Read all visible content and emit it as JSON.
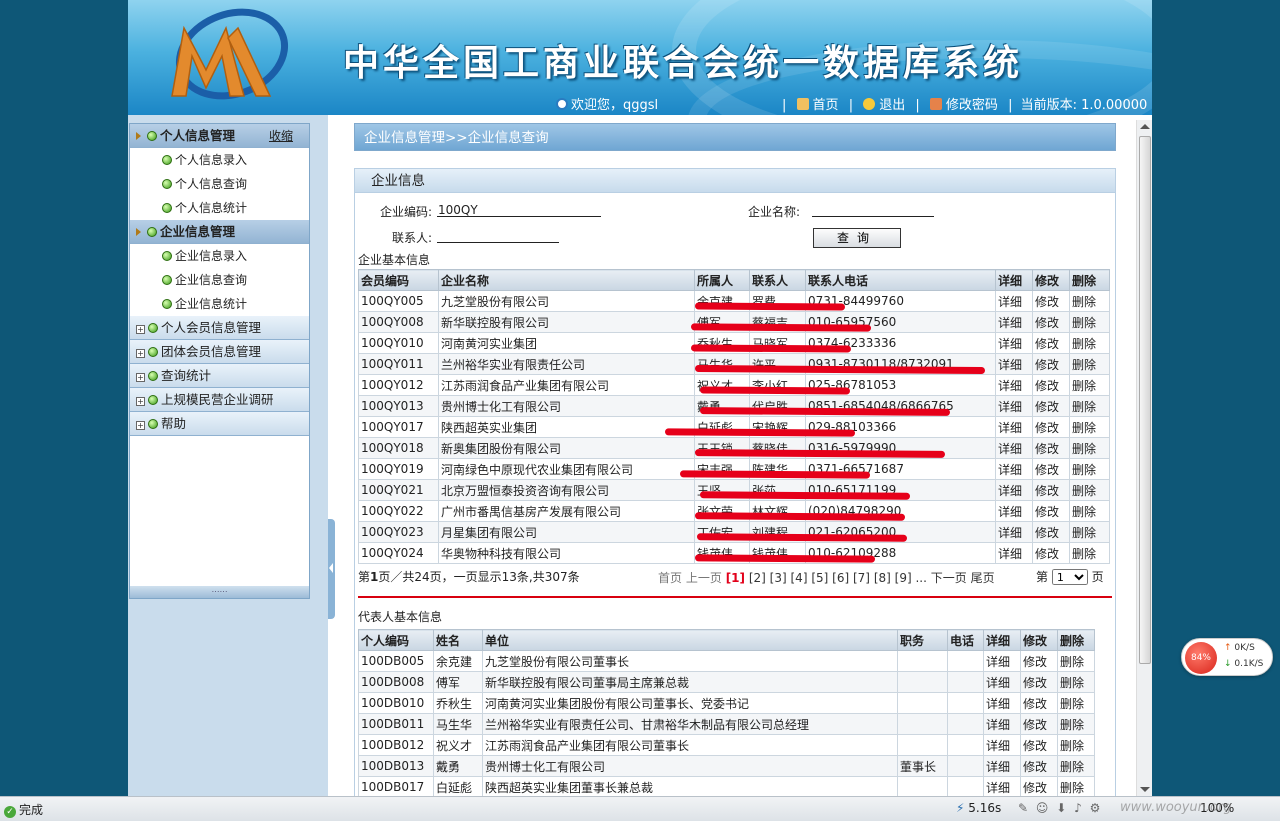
{
  "header": {
    "title": "中华全国工商业联合会统一数据库系统",
    "welcome": "欢迎您，qggsl",
    "nav": {
      "home": "首页",
      "logout": "退出",
      "change_password": "修改密码",
      "version": "当前版本: 1.0.00000"
    }
  },
  "sidebar": {
    "collapse_label": "收缩",
    "groups": [
      {
        "label": "个人信息管理",
        "open": true,
        "items": [
          "个人信息录入",
          "个人信息查询",
          "个人信息统计"
        ]
      },
      {
        "label": "企业信息管理",
        "open": true,
        "items": [
          "企业信息录入",
          "企业信息查询",
          "企业信息统计"
        ]
      },
      {
        "label": "个人会员信息管理",
        "open": false,
        "items": []
      },
      {
        "label": "团体会员信息管理",
        "open": false,
        "items": []
      },
      {
        "label": "查询统计",
        "open": false,
        "items": []
      },
      {
        "label": "上规模民营企业调研",
        "open": false,
        "items": []
      },
      {
        "label": "帮助",
        "open": false,
        "items": []
      }
    ]
  },
  "main": {
    "breadcrumb": "企业信息管理>>企业信息查询",
    "panel_title": "企业信息",
    "form": {
      "code_label": "企业编码:",
      "code_value": "100QY",
      "name_label": "企业名称:",
      "name_value": "",
      "contact_label": "联系人:",
      "contact_value": "",
      "query_button": "查询"
    },
    "enterprise_section": "企业基本信息",
    "enterprise_headers": [
      "会员编码",
      "企业名称",
      "所属人",
      "联系人",
      "联系人电话",
      "详细",
      "修改",
      "删除"
    ],
    "enterprise_rows": [
      {
        "code": "100QY005",
        "name": "九芝堂股份有限公司",
        "owner": "余克建",
        "contact": "罗费",
        "phone": "0731-84499760"
      },
      {
        "code": "100QY008",
        "name": "新华联控股有限公司",
        "owner": "傅军",
        "contact": "蔡福吉",
        "phone": "010-65957560"
      },
      {
        "code": "100QY010",
        "name": "河南黄河实业集团",
        "owner": "乔秋生",
        "contact": "马晓军",
        "phone": "0374-6233336"
      },
      {
        "code": "100QY011",
        "name": "兰州裕华实业有限责任公司",
        "owner": "马生华",
        "contact": "许平",
        "phone": "0931-8730118/8732091"
      },
      {
        "code": "100QY012",
        "name": "江苏雨润食品产业集团有限公司",
        "owner": "祝义才",
        "contact": "李小红",
        "phone": "025-86781053"
      },
      {
        "code": "100QY013",
        "name": "贵州博士化工有限公司",
        "owner": "戴勇",
        "contact": "代启胜",
        "phone": "0851-6854048/6866765"
      },
      {
        "code": "100QY017",
        "name": "陕西超英实业集团",
        "owner": "白延彪",
        "contact": "宋艳辉",
        "phone": "029-88103366"
      },
      {
        "code": "100QY018",
        "name": "新奥集团股份有限公司",
        "owner": "王玉锁",
        "contact": "蔡晓佳",
        "phone": "0316-5979990"
      },
      {
        "code": "100QY019",
        "name": "河南绿色中原现代农业集团有限公司",
        "owner": "宋丰强",
        "contact": "陈建华",
        "phone": "0371-66571687"
      },
      {
        "code": "100QY021",
        "name": "北京万盟恒泰投资咨询有限公司",
        "owner": "王坚",
        "contact": "张莎",
        "phone": "010-65171199"
      },
      {
        "code": "100QY022",
        "name": "广州市番禺信基房产发展有限公司",
        "owner": "张文荣",
        "contact": "林文辉",
        "phone": "(020)84798290"
      },
      {
        "code": "100QY023",
        "name": "月星集团有限公司",
        "owner": "丁佐宏",
        "contact": "刘建程",
        "phone": "021-62065200"
      },
      {
        "code": "100QY024",
        "name": "华奥物种科技有限公司",
        "owner": "钱茂伟",
        "contact": "钱茂伟",
        "phone": "010-62109288"
      }
    ],
    "row_actions": {
      "detail": "详细",
      "edit": "修改",
      "delete": "删除"
    },
    "pager": {
      "summary_prefix": "第",
      "summary_page": "1",
      "summary_suffix": "页／共24页，一页显示13条,共307条",
      "first": "首页",
      "prev": "上一页",
      "current": "[1]",
      "pages": [
        "[2]",
        "[3]",
        "[4]",
        "[5]",
        "[6]",
        "[7]",
        "[8]",
        "[9]"
      ],
      "ellipsis": "...",
      "next": "下一页",
      "last": "尾页",
      "jump_prefix": "第",
      "jump_value": "1",
      "jump_suffix": "页"
    },
    "rep_section": "代表人基本信息",
    "rep_headers": [
      "个人编码",
      "姓名",
      "单位",
      "职务",
      "电话",
      "详细",
      "修改",
      "删除"
    ],
    "rep_rows": [
      {
        "code": "100DB005",
        "name": "余克建",
        "unit": "九芝堂股份有限公司董事长",
        "title": "",
        "phone": ""
      },
      {
        "code": "100DB008",
        "name": "傅军",
        "unit": "新华联控股有限公司董事局主席兼总裁",
        "title": "",
        "phone": ""
      },
      {
        "code": "100DB010",
        "name": "乔秋生",
        "unit": "河南黄河实业集团股份有限公司董事长、党委书记",
        "title": "",
        "phone": ""
      },
      {
        "code": "100DB011",
        "name": "马生华",
        "unit": "兰州裕华实业有限责任公司、甘肃裕华木制品有限公司总经理",
        "title": "",
        "phone": ""
      },
      {
        "code": "100DB012",
        "name": "祝义才",
        "unit": "江苏雨润食品产业集团有限公司董事长",
        "title": "",
        "phone": ""
      },
      {
        "code": "100DB013",
        "name": "戴勇",
        "unit": "贵州博士化工有限公司",
        "title": "董事长",
        "phone": ""
      },
      {
        "code": "100DB017",
        "name": "白延彪",
        "unit": "陕西超英实业集团董事长兼总裁",
        "title": "",
        "phone": ""
      }
    ]
  },
  "net_widget": {
    "percent": "84%",
    "up": "0K/S",
    "down": "0.1K/S"
  },
  "statusbar": {
    "status": "完成",
    "time": "5.16s",
    "zoom": "100%"
  },
  "watermark": "www.wooyun.org",
  "colors": {
    "redaction": "#e6001a",
    "header_blue": "#1b86c6",
    "page_bg": "#0e5777"
  }
}
